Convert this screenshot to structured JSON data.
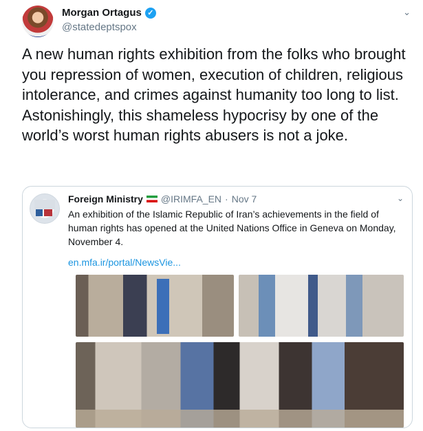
{
  "tweet": {
    "author_name": "Morgan Ortagus",
    "author_handle": "@statedeptspox",
    "text": "A new human rights exhibition from the folks who brought you repression of women, execution of children, religious intolerance, and crimes against humanity too long to list. Astonishingly, this shameless hypocrisy by one of the world’s worst human rights abusers is not a joke.",
    "verified_glyph": "✓",
    "menu_glyph": "⌄",
    "icon_names": [
      "verified-badge-icon",
      "chevron-down-icon"
    ]
  },
  "quoted": {
    "author_name": "Foreign Ministry",
    "handle": "@IRIMFA_EN",
    "separator": "·",
    "date": "Nov 7",
    "text": "An exhibition of the Islamic Republic of Iran’s achievements in the field of human rights has opened at the United Nations Office in Geneva on Monday, November 4.",
    "link": "en.mfa.ir/portal/NewsVie...",
    "menu_glyph": "⌄",
    "icon_names": [
      "iran-flag-icon",
      "chevron-down-icon"
    ]
  },
  "colors": {
    "link": "#1b95e0",
    "verified": "#1da1f2",
    "secondary_text": "#657786",
    "border": "#ccd6dd"
  }
}
